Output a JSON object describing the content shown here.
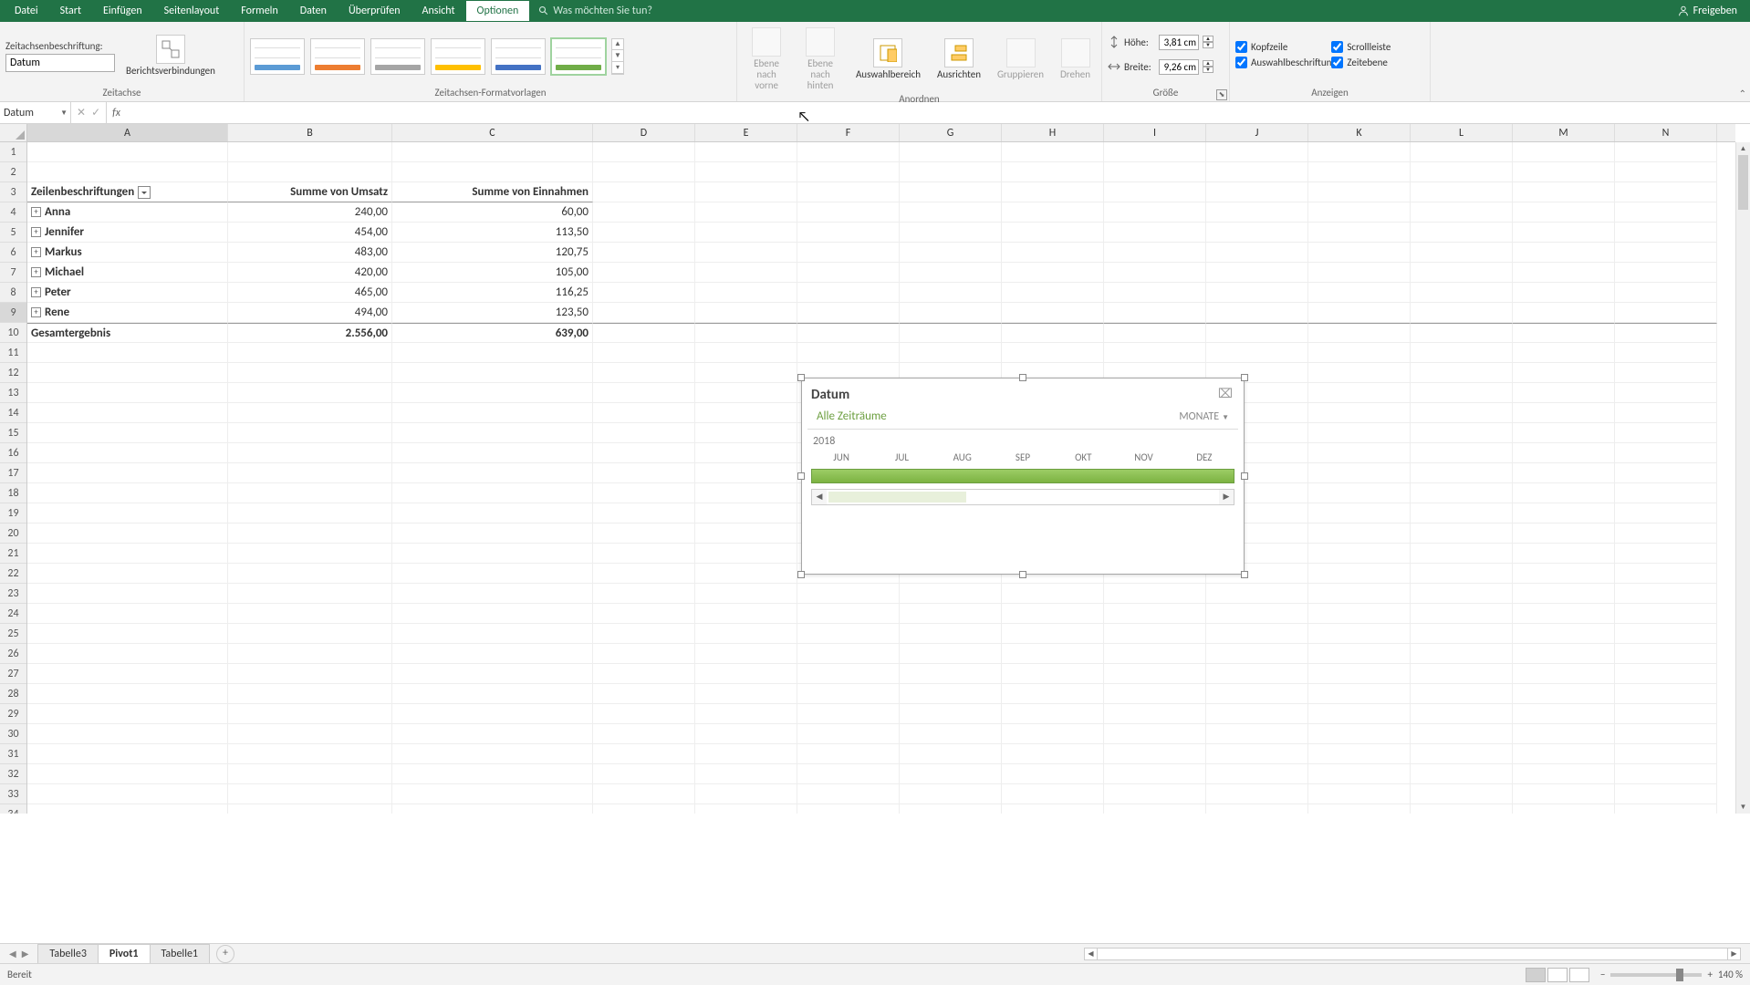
{
  "tabs": {
    "file": "Datei",
    "home": "Start",
    "insert": "Einfügen",
    "layout": "Seitenlayout",
    "formulas": "Formeln",
    "data": "Daten",
    "review": "Überprüfen",
    "view": "Ansicht",
    "options": "Optionen",
    "tellme": "Was möchten Sie tun?",
    "share": "Freigeben"
  },
  "ribbon": {
    "caption_label": "Zeitachsenbeschriftung:",
    "caption_value": "Datum",
    "connections": "Berichtsverbindungen",
    "group_timeline": "Zeitachse",
    "group_styles": "Zeitachsen-Formatvorlagen",
    "bring_forward": "Ebene nach vorne",
    "send_backward": "Ebene nach hinten",
    "selection_pane": "Auswahlbereich",
    "align": "Ausrichten",
    "group": "Gruppieren",
    "rotate": "Drehen",
    "group_arrange": "Anordnen",
    "height_label": "Höhe:",
    "height_value": "3,81 cm",
    "width_label": "Breite:",
    "width_value": "9,26 cm",
    "group_size": "Größe",
    "header_check": "Kopfzeile",
    "scrollbar_check": "Scrollleiste",
    "sel_label_check": "Auswahlbeschriftung",
    "time_level_check": "Zeitebene",
    "group_show": "Anzeigen"
  },
  "namebox": "Datum",
  "columns": [
    "A",
    "B",
    "C",
    "D",
    "E",
    "F",
    "G",
    "H",
    "I",
    "J",
    "K",
    "L",
    "M",
    "N"
  ],
  "pivot": {
    "header1": "Zeilenbeschriftungen",
    "header2": "Summe von Umsatz",
    "header3": "Summe von Einnahmen",
    "rows": [
      {
        "name": "Anna",
        "v1": "240,00",
        "v2": "60,00"
      },
      {
        "name": "Jennifer",
        "v1": "454,00",
        "v2": "113,50"
      },
      {
        "name": "Markus",
        "v1": "483,00",
        "v2": "120,75"
      },
      {
        "name": "Michael",
        "v1": "420,00",
        "v2": "105,00"
      },
      {
        "name": "Peter",
        "v1": "465,00",
        "v2": "116,25"
      },
      {
        "name": "Rene",
        "v1": "494,00",
        "v2": "123,50"
      }
    ],
    "total_label": "Gesamtergebnis",
    "total_v1": "2.556,00",
    "total_v2": "639,00"
  },
  "slicer": {
    "title": "Datum",
    "period": "Alle Zeiträume",
    "level": "MONATE",
    "year": "2018",
    "months": [
      "JUN",
      "JUL",
      "AUG",
      "SEP",
      "OKT",
      "NOV",
      "DEZ"
    ]
  },
  "sheets": {
    "nav1": "Tabelle3",
    "nav2": "Pivot1",
    "nav3": "Tabelle1"
  },
  "status": {
    "ready": "Bereit",
    "zoom": "140 %"
  }
}
